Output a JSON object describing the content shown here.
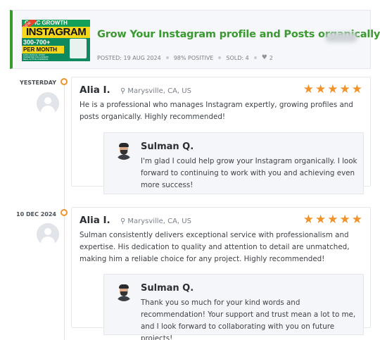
{
  "service": {
    "thumbnail": {
      "ribbon": "NEW",
      "top_text": "OR   IC GROWTH",
      "main_text": "INSTAGRAM",
      "count_text": "300-700+",
      "month_text": "PER MONTH",
      "bullets": [
        "100% MANUAL WORK",
        "TARGETED FOLLOWERS",
        "REAL ACTIVE AUDIENCE"
      ]
    },
    "title": "Grow Your Instagram profile and Posts organically",
    "posted": "POSTED: 19 AUG 2024",
    "positive": "98% POSITIVE",
    "sold": "SOLD: 4",
    "likes": "2",
    "heart_icon": "heart-icon",
    "accent_color": "#3a9a2f"
  },
  "reviews": [
    {
      "date": "YESTERDAY",
      "name": "Alia I.",
      "location": "Marysville, CA, US",
      "stars": "★★★★★",
      "rating": 5,
      "text": "He is a professional who manages Instagram expertly, growing profiles and posts organically. Highly recommended!",
      "reply": {
        "name": "Sulman Q.",
        "text": "I'm glad I could help grow your Instagram organically. I look forward to continuing to work with you and achieving even more success!"
      }
    },
    {
      "date": "10 DEC 2024",
      "name": "Alia I.",
      "location": "Marysville, CA, US",
      "stars": "★★★★★",
      "rating": 5,
      "text": "Sulman consistently delivers exceptional service with professionalism and expertise. His dedication to quality and attention to detail are unmatched, making him a reliable choice for any project. Highly recommended!",
      "reply": {
        "name": "Sulman Q.",
        "text": "Thank you so much for your kind words and recommendation! Your support and trust mean a lot to me, and I look forward to collaborating with you on future projects!"
      }
    }
  ],
  "colors": {
    "star": "#f0932b",
    "timeline_dot": "#f0932b"
  }
}
